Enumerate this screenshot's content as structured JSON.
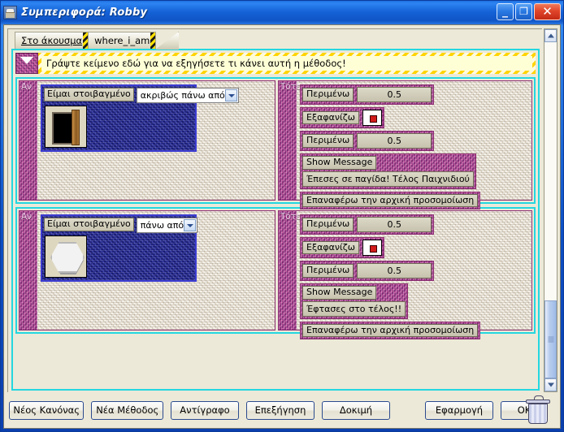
{
  "window": {
    "title": "Συμπεριφορά: Robby",
    "icon": "robot-icon",
    "minimize_label": "_",
    "maximize_label": "❐",
    "close_label": "✕"
  },
  "tabs": [
    {
      "label": "Στο άκουσμα",
      "active": true
    },
    {
      "label": "where_i_am",
      "active": false
    }
  ],
  "note": {
    "text": "Γράψτε κείμενο εδώ για να εξηγήσετε τι κάνει αυτή η μέθοδος!",
    "handle_icon": "collapse-triangle-icon"
  },
  "columns": {
    "if_label": "Αν",
    "then_label": "Τότε"
  },
  "rules": [
    {
      "condition": {
        "label": "Είμαι στοιβαγμένο",
        "selected_option": "ακριβώς πάνω από",
        "object_icon": "door-icon"
      },
      "actions": [
        {
          "type": "value",
          "label": "Περιμένω",
          "value": "0.5"
        },
        {
          "type": "icon",
          "label": "Εξαφανίζω",
          "icon": "red-dot-icon"
        },
        {
          "type": "value",
          "label": "Περιμένω",
          "value": "0.5"
        },
        {
          "type": "message",
          "label": "Show Message",
          "message": "Έπεσες σε παγίδα! Τέλος Παιχνιδιού",
          "align": "left"
        },
        {
          "type": "single",
          "label": "Επαναφέρω την αρχική προσομοίωση"
        }
      ]
    },
    {
      "condition": {
        "label": "Είμαι στοιβαγμένο",
        "selected_option": "πάνω από",
        "object_icon": "hexagon-icon"
      },
      "actions": [
        {
          "type": "value",
          "label": "Περιμένω",
          "value": "0.5"
        },
        {
          "type": "icon",
          "label": "Εξαφανίζω",
          "icon": "red-dot-icon"
        },
        {
          "type": "value",
          "label": "Περιμένω",
          "value": "0.5"
        },
        {
          "type": "message",
          "label": "Show Message",
          "message": "Έφτασες στο τέλος!!",
          "align": "center"
        },
        {
          "type": "single",
          "label": "Επαναφέρω την αρχική προσομοίωση"
        }
      ]
    }
  ],
  "buttons": {
    "new_rule": "Νέος Κανόνας",
    "new_method": "Νέα Μέθοδος",
    "copy": "Αντίγραφο",
    "explain": "Επεξήγηση",
    "test": "Δοκιμή",
    "apply": "Εφαρμογή",
    "ok": "OK",
    "trash_icon": "trash-icon"
  },
  "colors": {
    "titlebar": "#1461d6",
    "frame_accent": "#24d7e0",
    "rule_border": "#8e2f72",
    "note_bg": "#ffffd6",
    "hazard": "#ffd400",
    "client_bg": "#ece9d8"
  }
}
